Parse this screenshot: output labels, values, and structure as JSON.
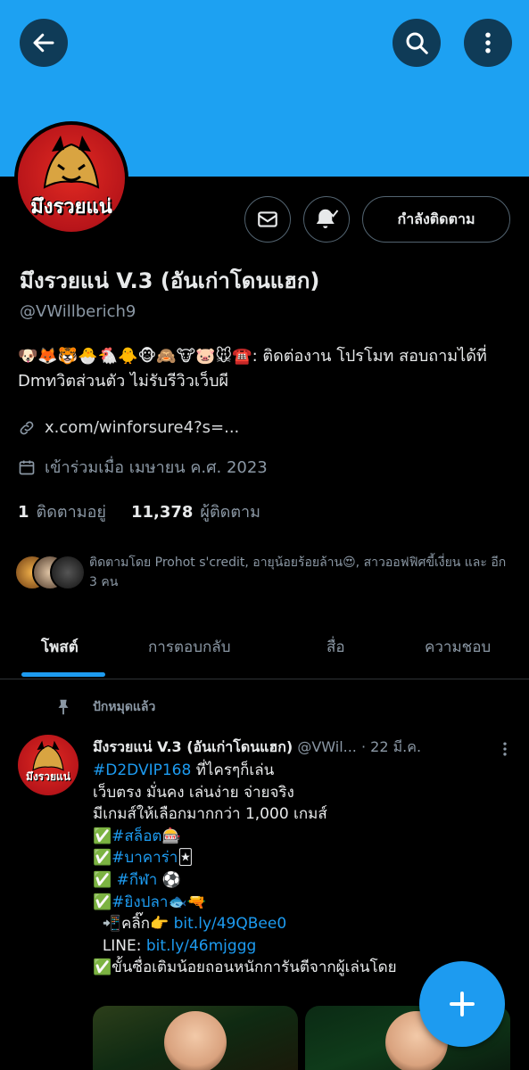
{
  "colors": {
    "banner": "#1da1f2",
    "accent": "#1d9bf0",
    "text": "#e7e9ea",
    "muted": "#8b98a5",
    "avatar_red": "#c41b1f"
  },
  "topbar": {
    "back_icon": "arrow-left-icon",
    "search_icon": "search-icon",
    "more_icon": "more-vertical-icon"
  },
  "profile": {
    "avatar_text": "มึงรวยแน่",
    "name": "มึงรวยแน่ V.3 (อันเก่าโดนแฮก)",
    "handle": "@VWillberich9",
    "bio_emojis": "🐶🦊🐯🐣🐔🐥🐵🙈🐮🐷🐭☎️",
    "bio_text": ": ติดต่องาน โปรโมท สอบถามได้ที่ Dmทวิตส่วนตัว ไม่รับรีวิวเว็บผี",
    "link": "x.com/winforsure4?s=...",
    "joined": "เข้าร่วมเมื่อ เมษายน ค.ศ. 2023",
    "following_count": "1",
    "following_label": "ติดตามอยู่",
    "followers_count": "11,378",
    "followers_label": "ผู้ติดตาม",
    "followed_by": "ติดตามโดย Prohot s'credit, อายุน้อยร้อยล้าน😍, สาวออฟฟิศขี้เงี่ยน และ อีก 3 คน"
  },
  "actions": {
    "message_icon": "envelope-icon",
    "notify_icon": "bell-check-icon",
    "follow_label": "กำลังติดตาม"
  },
  "tabs": [
    {
      "label": "โพสต์",
      "active": true
    },
    {
      "label": "การตอบกลับ",
      "active": false
    },
    {
      "label": "สื่อ",
      "active": false
    },
    {
      "label": "ความชอบ",
      "active": false
    }
  ],
  "post": {
    "pinned_label": "ปักหมุดแล้ว",
    "author_name": "มึงรวยแน่ V.3 (อันเก่าโดนแฮก)",
    "author_handle": "@VWil...",
    "date": "· 22 มี.ค.",
    "lines": [
      {
        "tag": "#D2DVIP168",
        "text": " ที่ไครๆก็เล่น"
      },
      {
        "tag": "",
        "text": "เว็บตรง มั่นคง เล่นง่าย จ่ายจริง"
      },
      {
        "tag": "",
        "text": "มีเกมส์ให้เลือกมากกว่า 1,000 เกมส์"
      },
      {
        "tag": "#สล็อต",
        "text": "🎰",
        "prefix": "✅"
      },
      {
        "tag": "#บาคาร่า",
        "text": "🃏",
        "prefix": "✅"
      },
      {
        "tag": "#กีฬา",
        "text": " ⚽",
        "prefix": "✅ "
      },
      {
        "tag": "#ยิงปลา",
        "text": "🐟🔫",
        "prefix": "✅"
      },
      {
        "tag": "bit.ly/49QBee0",
        "text": "",
        "prefix": "  📲คลิ๊ก👉 "
      },
      {
        "tag": "bit.ly/46mjggg",
        "text": "",
        "prefix": "  LINE: "
      },
      {
        "tag": "",
        "text": "ขั้นซื่อเติมน้อยถอนหนักการันตีจากผู้เล่นโดย",
        "prefix": "✅"
      }
    ]
  },
  "fab": {
    "icon": "plus-icon"
  }
}
